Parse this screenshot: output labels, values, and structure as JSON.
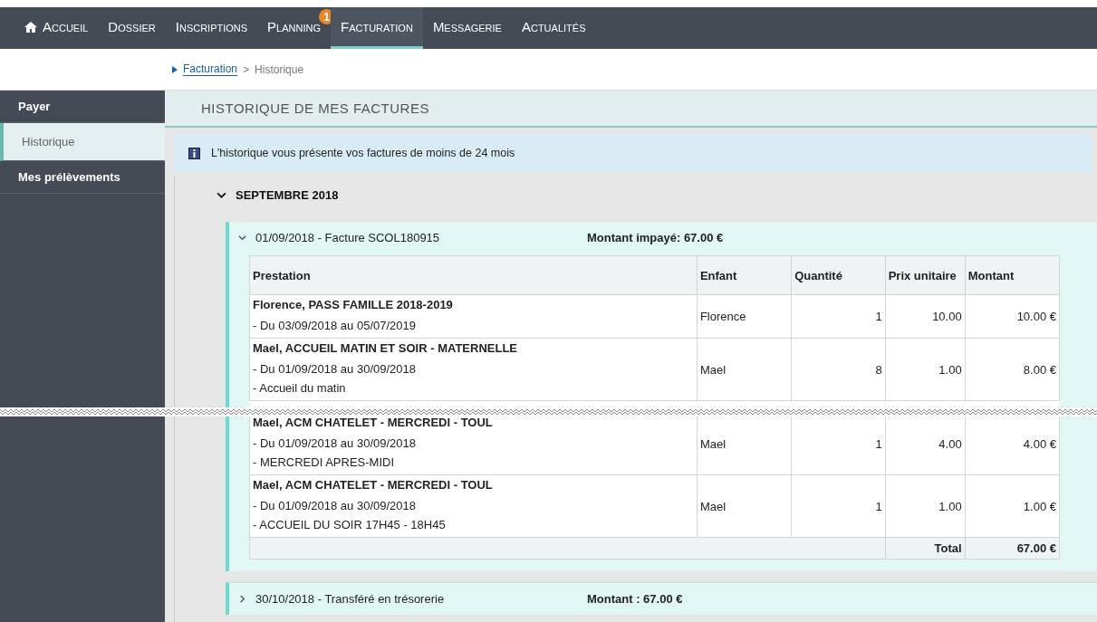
{
  "nav": [
    {
      "label": "Accueil",
      "selected": false
    },
    {
      "label": "Dossier",
      "selected": false
    },
    {
      "label": "Inscriptions",
      "selected": false
    },
    {
      "label": "Planning",
      "badge": "1",
      "selected": false
    },
    {
      "label": "Facturation",
      "selected": true
    },
    {
      "label": "Messagerie",
      "selected": false
    },
    {
      "label": "Actualités",
      "selected": false
    }
  ],
  "breadcrumb": {
    "link": "Facturation",
    "separator": ">",
    "current": "Historique"
  },
  "sidebar": {
    "items": [
      {
        "label": "Payer",
        "kind": "section",
        "selected": false
      },
      {
        "label": "Historique",
        "kind": "sub",
        "selected": true
      },
      {
        "label": "Mes prélèvements",
        "kind": "section",
        "selected": false
      }
    ]
  },
  "page_title": "HISTORIQUE DE MES FACTURES",
  "info": "L'historique vous présente vos factures de moins de 24 mois",
  "month": {
    "label": "SEPTEMBRE 2018",
    "expanded": true,
    "invoices": [
      {
        "label": "01/09/2018 - Facture SCOL180915",
        "amount": "Montant impayé: 67.00 €",
        "expanded": true,
        "table": {
          "columns": [
            "Prestation",
            "Enfant",
            "Quantité",
            "Prix unitaire",
            "Montant"
          ],
          "rows": [
            {
              "title": "Florence, PASS FAMILLE 2018-2019",
              "details": [
                "- Du 03/09/2018 au 05/07/2019"
              ],
              "child": "Florence",
              "qty": "1",
              "price": "10.00",
              "amount": "10.00 €"
            },
            {
              "title": "Mael, ACCUEIL MATIN ET SOIR - MATERNELLE",
              "details": [
                "- Du 01/09/2018 au 30/09/2018",
                "- Accueil du matin"
              ],
              "child": "Mael",
              "qty": "8",
              "price": "1.00",
              "amount": "8.00 €"
            },
            {
              "title": "Mael, ACM CHATELET - MERCREDI - TOUL",
              "details": [
                "- Du 01/09/2018 au 30/09/2018",
                "- MERCREDI APRES-MIDI"
              ],
              "child": "Mael",
              "qty": "1",
              "price": "4.00",
              "amount": "4.00 €"
            },
            {
              "title": "Mael, ACM CHATELET - MERCREDI - TOUL",
              "details": [
                "- Du 01/09/2018 au 30/09/2018",
                "- ACCUEIL DU SOIR 17H45 - 18H45"
              ],
              "child": "Mael",
              "qty": "1",
              "price": "1.00",
              "amount": "1.00 €"
            }
          ],
          "total_label": "Total",
          "total": "67.00 €"
        }
      },
      {
        "label": "30/10/2018 - Transféré en trésorerie",
        "amount": "Montant : 67.00 €",
        "expanded": false
      }
    ]
  }
}
